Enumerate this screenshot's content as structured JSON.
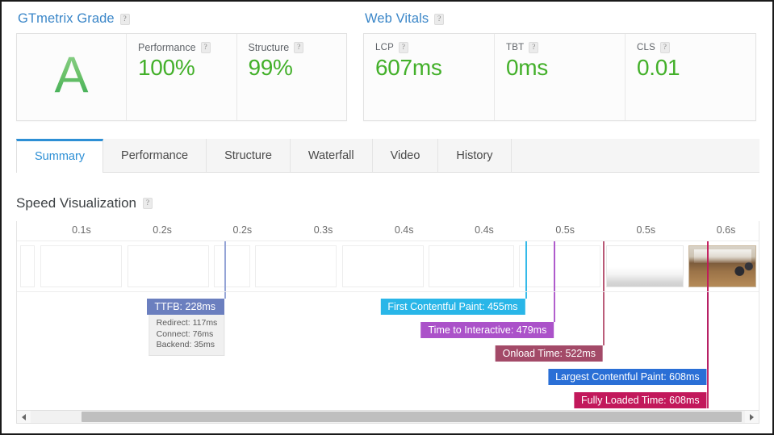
{
  "grade_panel": {
    "title": "GTmetrix Grade",
    "help": "?",
    "grade": "A",
    "metrics": [
      {
        "label": "Performance",
        "help": "?",
        "value": "100%"
      },
      {
        "label": "Structure",
        "help": "?",
        "value": "99%"
      }
    ]
  },
  "vitals_panel": {
    "title": "Web Vitals",
    "help": "?",
    "metrics": [
      {
        "label": "LCP",
        "help": "?",
        "value": "607ms"
      },
      {
        "label": "TBT",
        "help": "?",
        "value": "0ms"
      },
      {
        "label": "CLS",
        "help": "?",
        "value": "0.01"
      }
    ]
  },
  "tabs": [
    {
      "label": "Summary",
      "active": true
    },
    {
      "label": "Performance",
      "active": false
    },
    {
      "label": "Structure",
      "active": false
    },
    {
      "label": "Waterfall",
      "active": false
    },
    {
      "label": "Video",
      "active": false
    },
    {
      "label": "History",
      "active": false
    }
  ],
  "speed_visualization": {
    "title": "Speed Visualization",
    "help": "?"
  },
  "chart_data": {
    "type": "timeline",
    "title": "Speed Visualization",
    "xlabel": "",
    "axis_ticks": [
      "0.1s",
      "0.2s",
      "0.2s",
      "0.3s",
      "0.4s",
      "0.4s",
      "0.5s",
      "0.5s",
      "0.6s"
    ],
    "tick_positions_pct": [
      8.7,
      19.6,
      30.4,
      41.3,
      52.2,
      63.0,
      73.9,
      84.8,
      95.6
    ],
    "events": [
      {
        "name": "TTFB",
        "label": "TTFB: 228ms",
        "value_ms": 228,
        "color": "#6b7fbf",
        "line_color": "#8f9fd4",
        "position_pct": 28.0,
        "details": [
          "Redirect: 117ms",
          "Connect: 76ms",
          "Backend: 35ms"
        ]
      },
      {
        "name": "First Contentful Paint",
        "label": "First Contentful Paint: 455ms",
        "value_ms": 455,
        "color": "#29b6e8",
        "line_color": "#29b6e8",
        "position_pct": 68.5
      },
      {
        "name": "Time to Interactive",
        "label": "Time to Interactive: 479ms",
        "value_ms": 479,
        "color": "#ab52c9",
        "line_color": "#ab52c9",
        "position_pct": 72.4
      },
      {
        "name": "Onload Time",
        "label": "Onload Time: 522ms",
        "value_ms": 522,
        "color": "#a34a68",
        "line_color": "#b5506f",
        "position_pct": 79.0
      },
      {
        "name": "Largest Contentful Paint",
        "label": "Largest Contentful Paint: 608ms",
        "value_ms": 608,
        "color": "#2a6fd6",
        "line_color": "#2a6fd6",
        "position_pct": 93.0
      },
      {
        "name": "Fully Loaded Time",
        "label": "Fully Loaded Time: 608ms",
        "value_ms": 608,
        "color": "#c2185b",
        "line_color": "#c2185b",
        "position_pct": 93.0
      }
    ],
    "frames": [
      {
        "kind": "blank",
        "left_pct": 0.4,
        "width_pct": 2.0
      },
      {
        "kind": "blank",
        "left_pct": 3.2,
        "width_pct": 11.0
      },
      {
        "kind": "blank",
        "left_pct": 14.9,
        "width_pct": 11.0
      },
      {
        "kind": "blank",
        "left_pct": 26.6,
        "width_pct": 4.8
      },
      {
        "kind": "blank",
        "left_pct": 32.1,
        "width_pct": 11.0
      },
      {
        "kind": "blank",
        "left_pct": 43.8,
        "width_pct": 11.0
      },
      {
        "kind": "blank",
        "left_pct": 55.5,
        "width_pct": 11.5
      },
      {
        "kind": "blank",
        "left_pct": 67.7,
        "width_pct": 11.0
      },
      {
        "kind": "partial",
        "left_pct": 79.4,
        "width_pct": 10.5
      },
      {
        "kind": "photo",
        "left_pct": 90.5,
        "width_pct": 9.2
      }
    ]
  },
  "scrollbar": {
    "left_arrow": "◀",
    "right_arrow": "▶"
  }
}
